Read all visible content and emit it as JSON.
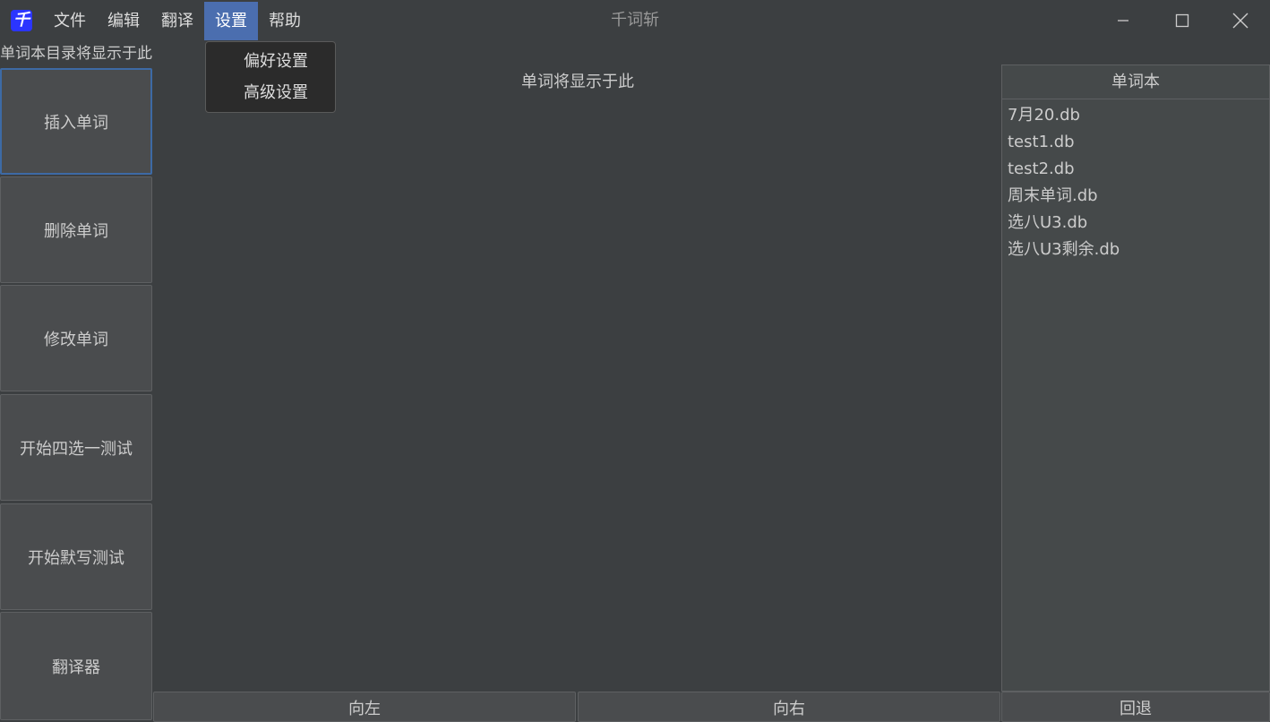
{
  "app": {
    "title": "千词斩",
    "icon_glyph": "千",
    "icon_color": "#2b35ff"
  },
  "menu": {
    "items": [
      {
        "label": "文件"
      },
      {
        "label": "编辑"
      },
      {
        "label": "翻译"
      },
      {
        "label": "设置",
        "active": true
      },
      {
        "label": "帮助"
      }
    ]
  },
  "settings_menu": {
    "items": [
      {
        "label": "偏好设置"
      },
      {
        "label": "高级设置"
      }
    ]
  },
  "directory_label": "单词本目录将显示于此",
  "sidebar": {
    "buttons": [
      {
        "label": "插入单词"
      },
      {
        "label": "删除单词"
      },
      {
        "label": "修改单词"
      },
      {
        "label": "开始四选一测试"
      },
      {
        "label": "开始默写测试"
      },
      {
        "label": "翻译器"
      }
    ]
  },
  "main": {
    "word_placeholder": "单词将显示于此"
  },
  "wordbook": {
    "header": "单词本",
    "items": [
      "7月20.db",
      "test1.db",
      "test2.db",
      "周末单词.db",
      "选八U3.db",
      "选八U3剩余.db"
    ]
  },
  "bottom": {
    "left_label": "向左",
    "right_label": "向右",
    "back_label": "回退"
  },
  "colors": {
    "background": "#3c3f41",
    "accent": "#4b6eaf"
  }
}
